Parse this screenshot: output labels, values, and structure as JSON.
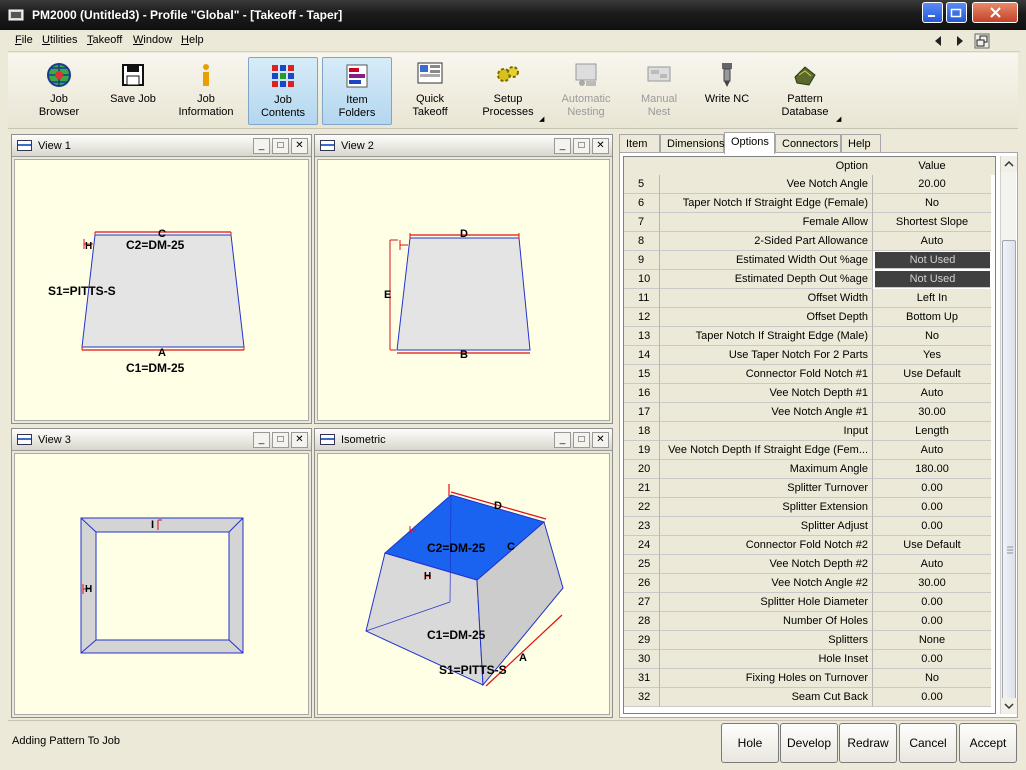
{
  "window": {
    "title": "PM2000 (Untitled3) - Profile \"Global\" - [Takeoff - Taper]",
    "colors": {
      "accent": "#3a6bd0",
      "view_bg": "#ffffe6",
      "iso_top": "#1a62f0"
    }
  },
  "menu": [
    "File",
    "Utilities",
    "Takeoff",
    "Window",
    "Help"
  ],
  "toolbar": [
    {
      "label1": "Job",
      "label2": "Browser",
      "icon": "globe-grid-icon"
    },
    {
      "label1": "Save Job",
      "label2": "",
      "icon": "floppy-icon"
    },
    {
      "label1": "Job",
      "label2": "Information",
      "icon": "info-icon"
    },
    {
      "label1": "Job",
      "label2": "Contents",
      "icon": "grid-icon"
    },
    {
      "label1": "Item",
      "label2": "Folders",
      "icon": "folders-icon"
    },
    {
      "label1": "Quick",
      "label2": "Takeoff",
      "icon": "quick-takeoff-icon"
    },
    {
      "label1": "Setup",
      "label2": "Processes",
      "icon": "gears-icon"
    },
    {
      "label1": "Automatic",
      "label2": "Nesting",
      "icon": "automatic-nesting-icon"
    },
    {
      "label1": "Manual",
      "label2": "Nest",
      "icon": "manual-nest-icon"
    },
    {
      "label1": "Write NC",
      "label2": "",
      "icon": "cnc-tool-icon"
    },
    {
      "label1": "Pattern",
      "label2": "Database",
      "icon": "pattern-database-icon"
    }
  ],
  "views": [
    {
      "title": "View 1",
      "labels": [
        "C",
        "C2=DM-25",
        "H",
        "S1=PITTS-S",
        "A",
        "C1=DM-25"
      ]
    },
    {
      "title": "View 2",
      "labels": [
        "D",
        "E",
        "B"
      ]
    },
    {
      "title": "View 3",
      "labels": [
        "I",
        "H"
      ]
    },
    {
      "title": "Isometric",
      "labels": [
        "D",
        "C2=DM-25",
        "C",
        "H",
        "C1=DM-25",
        "S1=PITTS-S",
        "A"
      ]
    }
  ],
  "tabs": [
    "Item",
    "Dimensions",
    "Options",
    "Connectors",
    "Help"
  ],
  "grid": {
    "header_option": "Option",
    "header_value": "Value",
    "rows": [
      {
        "n": "5",
        "option": "Vee Notch Angle",
        "value": "20.00"
      },
      {
        "n": "6",
        "option": "Taper Notch If Straight Edge (Female)",
        "value": "No"
      },
      {
        "n": "7",
        "option": "Female Allow",
        "value": "Shortest Slope"
      },
      {
        "n": "8",
        "option": "2-Sided Part Allowance",
        "value": "Auto"
      },
      {
        "n": "9",
        "option": "Estimated Width Out %age",
        "value": "Not Used",
        "dark": true
      },
      {
        "n": "10",
        "option": "Estimated Depth Out %age",
        "value": "Not Used",
        "dark": true
      },
      {
        "n": "11",
        "option": "Offset Width",
        "value": "Left In"
      },
      {
        "n": "12",
        "option": "Offset Depth",
        "value": "Bottom Up"
      },
      {
        "n": "13",
        "option": "Taper Notch If Straight Edge (Male)",
        "value": "No"
      },
      {
        "n": "14",
        "option": "Use Taper Notch For 2 Parts",
        "value": "Yes"
      },
      {
        "n": "15",
        "option": "Connector Fold Notch #1",
        "value": "Use Default"
      },
      {
        "n": "16",
        "option": "Vee Notch Depth #1",
        "value": "Auto"
      },
      {
        "n": "17",
        "option": "Vee Notch Angle #1",
        "value": "30.00"
      },
      {
        "n": "18",
        "option": "Input",
        "value": "Length"
      },
      {
        "n": "19",
        "option": "Vee Notch Depth If Straight Edge (Fem...",
        "value": "Auto"
      },
      {
        "n": "20",
        "option": "Maximum Angle",
        "value": "180.00"
      },
      {
        "n": "21",
        "option": "Splitter Turnover",
        "value": "0.00"
      },
      {
        "n": "22",
        "option": "Splitter Extension",
        "value": "0.00"
      },
      {
        "n": "23",
        "option": "Splitter Adjust",
        "value": "0.00"
      },
      {
        "n": "24",
        "option": "Connector Fold Notch #2",
        "value": "Use Default"
      },
      {
        "n": "25",
        "option": "Vee Notch Depth #2",
        "value": "Auto"
      },
      {
        "n": "26",
        "option": "Vee Notch Angle #2",
        "value": "30.00"
      },
      {
        "n": "27",
        "option": "Splitter Hole Diameter",
        "value": "0.00"
      },
      {
        "n": "28",
        "option": "Number Of Holes",
        "value": "0.00"
      },
      {
        "n": "29",
        "option": "Splitters",
        "value": "None"
      },
      {
        "n": "30",
        "option": "Hole Inset",
        "value": "0.00"
      },
      {
        "n": "31",
        "option": "Fixing Holes on Turnover",
        "value": "No"
      },
      {
        "n": "32",
        "option": "Seam Cut Back",
        "value": "0.00"
      }
    ]
  },
  "status": {
    "text": "Adding Pattern To Job"
  },
  "buttons": [
    "Hole",
    "Develop",
    "Redraw",
    "Cancel",
    "Accept"
  ]
}
